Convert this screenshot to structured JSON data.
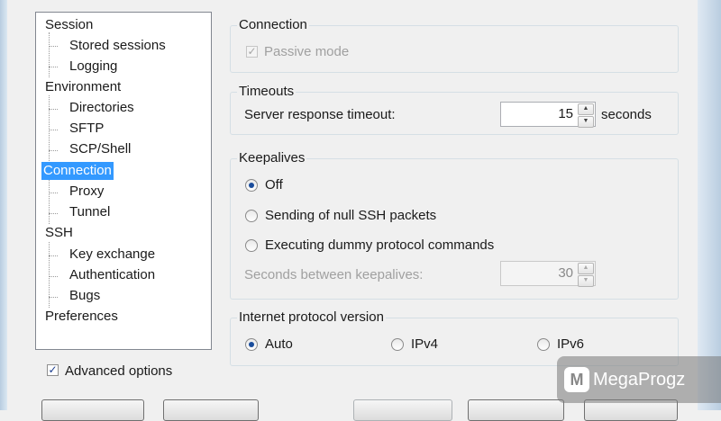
{
  "tree": {
    "items": [
      {
        "label": "Session",
        "level": 0,
        "selected": false
      },
      {
        "label": "Stored sessions",
        "level": 1,
        "selected": false
      },
      {
        "label": "Logging",
        "level": 1,
        "selected": false
      },
      {
        "label": "Environment",
        "level": 0,
        "selected": false
      },
      {
        "label": "Directories",
        "level": 1,
        "selected": false
      },
      {
        "label": "SFTP",
        "level": 1,
        "selected": false
      },
      {
        "label": "SCP/Shell",
        "level": 1,
        "selected": false
      },
      {
        "label": "Connection",
        "level": 0,
        "selected": true
      },
      {
        "label": "Proxy",
        "level": 1,
        "selected": false
      },
      {
        "label": "Tunnel",
        "level": 1,
        "selected": false
      },
      {
        "label": "SSH",
        "level": 0,
        "selected": false
      },
      {
        "label": "Key exchange",
        "level": 1,
        "selected": false
      },
      {
        "label": "Authentication",
        "level": 1,
        "selected": false
      },
      {
        "label": "Bugs",
        "level": 1,
        "selected": false
      },
      {
        "label": "Preferences",
        "level": 0,
        "selected": false
      }
    ]
  },
  "advanced": {
    "label": "Advanced options",
    "checked": true
  },
  "connection": {
    "title": "Connection",
    "passive_mode": {
      "label": "Passive mode",
      "checked": true,
      "enabled": false
    }
  },
  "timeouts": {
    "title": "Timeouts",
    "server_response_label": "Server response timeout:",
    "value": "15",
    "unit": "seconds"
  },
  "keepalives": {
    "title": "Keepalives",
    "options": [
      {
        "label": "Off",
        "checked": true
      },
      {
        "label": "Sending of null SSH packets",
        "checked": false
      },
      {
        "label": "Executing dummy protocol commands",
        "checked": false
      }
    ],
    "seconds_label": "Seconds between keepalives:",
    "seconds_value": "30"
  },
  "ip_version": {
    "title": "Internet protocol version",
    "options": [
      {
        "label": "Auto",
        "checked": true
      },
      {
        "label": "IPv4",
        "checked": false
      },
      {
        "label": "IPv6",
        "checked": false
      }
    ]
  },
  "watermark": {
    "text": "MegaProgz",
    "logo": "M"
  }
}
